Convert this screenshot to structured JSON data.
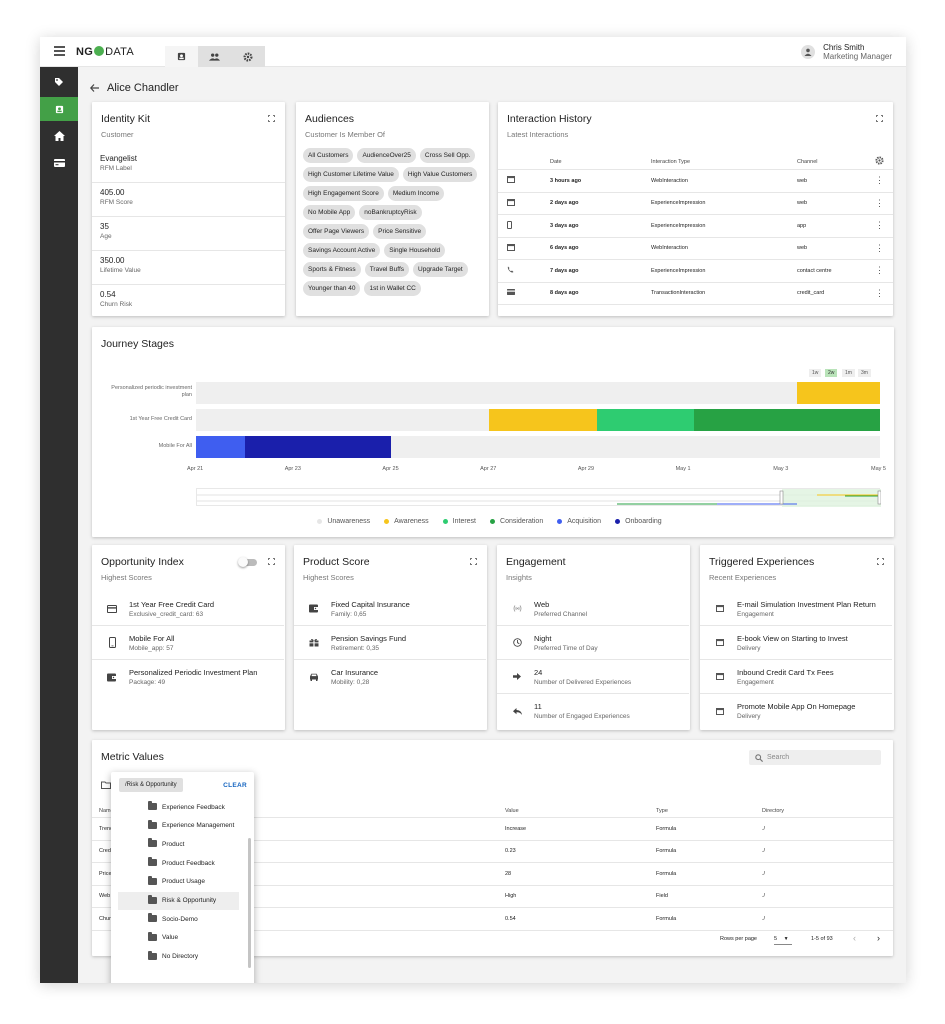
{
  "app": {
    "logo_left": "NG",
    "logo_right": "DATA"
  },
  "user": {
    "name": "Chris Smith",
    "role": "Marketing Manager"
  },
  "page": {
    "back_title": "Alice Chandler"
  },
  "identity_kit": {
    "title": "Identity Kit",
    "subtitle": "Customer",
    "rows": [
      {
        "value": "Evangelist",
        "label": "RFM Label"
      },
      {
        "value": "405.00",
        "label": "RFM Score"
      },
      {
        "value": "35",
        "label": "Age"
      },
      {
        "value": "350.00",
        "label": "Lifetime Value"
      },
      {
        "value": "0.54",
        "label": "Churn Risk"
      }
    ]
  },
  "audiences": {
    "title": "Audiences",
    "subtitle": "Customer Is Member Of",
    "chips": [
      "All Customers",
      "AudienceOver25",
      "Cross Sell Opp.",
      "High Customer Lifetime Value",
      "High Value Customers",
      "High Engagement Score",
      "Medium Income",
      "No Mobile App",
      "noBankruptcyRisk",
      "Offer Page Viewers",
      "Price Sensitive",
      "Savings Account Active",
      "Single Household",
      "Sports & Fitness",
      "Travel Buffs",
      "Upgrade Target",
      "Younger than 40",
      "1st in Wallet CC"
    ]
  },
  "interaction_history": {
    "title": "Interaction History",
    "subtitle": "Latest Interactions",
    "columns": [
      "Date",
      "Interaction Type",
      "Channel"
    ],
    "rows": [
      {
        "icon": "web-icon",
        "date": "3 hours ago",
        "type": "WebInteraction",
        "channel": "web"
      },
      {
        "icon": "web-icon",
        "date": "2 days ago",
        "type": "ExperienceImpression",
        "channel": "web"
      },
      {
        "icon": "phone-icon",
        "date": "3 days ago",
        "type": "ExperienceImpression",
        "channel": "app"
      },
      {
        "icon": "web-icon",
        "date": "6 days ago",
        "type": "WebInteraction",
        "channel": "web"
      },
      {
        "icon": "call-icon",
        "date": "7 days ago",
        "type": "ExperienceImpression",
        "channel": "contact centre"
      },
      {
        "icon": "card-icon",
        "date": "8 days ago",
        "type": "TransactionInteraction",
        "channel": "credit_card"
      }
    ]
  },
  "journey": {
    "title": "Journey Stages",
    "zoom_options": [
      "1w",
      "2w",
      "1m",
      "3m"
    ],
    "zoom_selected": "2w",
    "x_ticks": [
      "Apr 21",
      "Apr 23",
      "Apr 25",
      "Apr 27",
      "Apr 29",
      "May 1",
      "May 3",
      "May 5"
    ],
    "legend": [
      {
        "name": "Unawareness",
        "color": "#e6e6e6"
      },
      {
        "name": "Awareness",
        "color": "#f6c51c"
      },
      {
        "name": "Interest",
        "color": "#2ecc71"
      },
      {
        "name": "Consideration",
        "color": "#27a244"
      },
      {
        "name": "Acquisition",
        "color": "#3f5ef0"
      },
      {
        "name": "Onboarding",
        "color": "#1a1fab"
      }
    ]
  },
  "chart_data": {
    "type": "bar",
    "orientation": "horizontal-timeline",
    "title": "Journey Stages",
    "x_range": [
      "Apr 21",
      "May 5"
    ],
    "categories": [
      "Personalized periodic investment plan",
      "1st Year Free Credit Card",
      "Mobile For All"
    ],
    "series": [
      {
        "category": "Personalized periodic investment plan",
        "segments": [
          {
            "stage": "Unawareness",
            "start_day": 0,
            "end_day": 12.3
          },
          {
            "stage": "Awareness",
            "start_day": 12.3,
            "end_day": 14
          }
        ]
      },
      {
        "category": "1st Year Free Credit Card",
        "segments": [
          {
            "stage": "Unawareness",
            "start_day": 0,
            "end_day": 6
          },
          {
            "stage": "Awareness",
            "start_day": 6,
            "end_day": 8.2
          },
          {
            "stage": "Interest",
            "start_day": 8.2,
            "end_day": 10.2
          },
          {
            "stage": "Consideration",
            "start_day": 10.2,
            "end_day": 14
          }
        ]
      },
      {
        "category": "Mobile For All",
        "segments": [
          {
            "stage": "Acquisition",
            "start_day": 0,
            "end_day": 1
          },
          {
            "stage": "Onboarding",
            "start_day": 1,
            "end_day": 4
          },
          {
            "stage": "Unawareness",
            "start_day": 4,
            "end_day": 14
          }
        ]
      }
    ]
  },
  "opportunity": {
    "title": "Opportunity Index",
    "subtitle": "Highest Scores",
    "items": [
      {
        "icon": "credit-card-icon",
        "title": "1st Year Free Credit Card",
        "detail": "Exclusive_credit_card: 63"
      },
      {
        "icon": "mobile-icon",
        "title": "Mobile For All",
        "detail": "Mobile_app: 57"
      },
      {
        "icon": "wallet-icon",
        "title": "Personalized Periodic Investment Plan",
        "detail": "Package: 49"
      }
    ]
  },
  "product_score": {
    "title": "Product Score",
    "subtitle": "Highest Scores",
    "items": [
      {
        "icon": "wallet-icon",
        "title": "Fixed Capital Insurance",
        "detail": "Family: 0,65"
      },
      {
        "icon": "gift-icon",
        "title": "Pension Savings Fund",
        "detail": "Retirement: 0,35"
      },
      {
        "icon": "car-icon",
        "title": "Car Insurance",
        "detail": "Mobility: 0,28"
      }
    ]
  },
  "engagement": {
    "title": "Engagement",
    "subtitle": "Insights",
    "items": [
      {
        "icon": "signal-icon",
        "title": "Web",
        "detail": "Preferred Channel"
      },
      {
        "icon": "clock-icon",
        "title": "Night",
        "detail": "Preferred Time of Day"
      },
      {
        "icon": "arrow-right-icon",
        "title": "24",
        "detail": "Number of Delivered Experiences"
      },
      {
        "icon": "reply-icon",
        "title": "11",
        "detail": "Number of Engaged Experiences"
      }
    ]
  },
  "triggered": {
    "title": "Triggered Experiences",
    "subtitle": "Recent Experiences",
    "items": [
      {
        "icon": "web-icon",
        "title": "E-mail Simulation Investment Plan Return",
        "detail": "Engagement"
      },
      {
        "icon": "web-icon",
        "title": "E-book View on Starting to Invest",
        "detail": "Delivery"
      },
      {
        "icon": "web-icon",
        "title": "Inbound Credit Card Tx Fees",
        "detail": "Engagement"
      },
      {
        "icon": "web-icon",
        "title": "Promote Mobile App On Homepage",
        "detail": "Delivery"
      }
    ]
  },
  "metrics": {
    "title": "Metric Values",
    "search_placeholder": "Search",
    "columns": [
      "Name",
      "Value",
      "Type",
      "Directory"
    ],
    "rows": [
      {
        "name": "Trend",
        "value": "Increase",
        "type": "Formula",
        "dir": "./"
      },
      {
        "name": "Credit",
        "value": "0.23",
        "type": "Formula",
        "dir": "./"
      },
      {
        "name": "Price",
        "value": "28",
        "type": "Formula",
        "dir": "./"
      },
      {
        "name": "Web",
        "value": "High",
        "type": "Field",
        "dir": "./"
      },
      {
        "name": "Churn",
        "value": "0.54",
        "type": "Formula",
        "dir": "./"
      }
    ],
    "rows_per_page_label": "Rows per page",
    "rows_per_page": "5",
    "range": "1-5 of 93"
  },
  "directory_popup": {
    "current": "/Risk & Opportunity",
    "clear_label": "CLEAR",
    "items": [
      "Experience Feedback",
      "Experience Management",
      "Product",
      "Product Feedback",
      "Product Usage",
      "Risk & Opportunity",
      "Socio-Demo",
      "Value",
      "No Directory"
    ],
    "selected": "Risk & Opportunity"
  }
}
